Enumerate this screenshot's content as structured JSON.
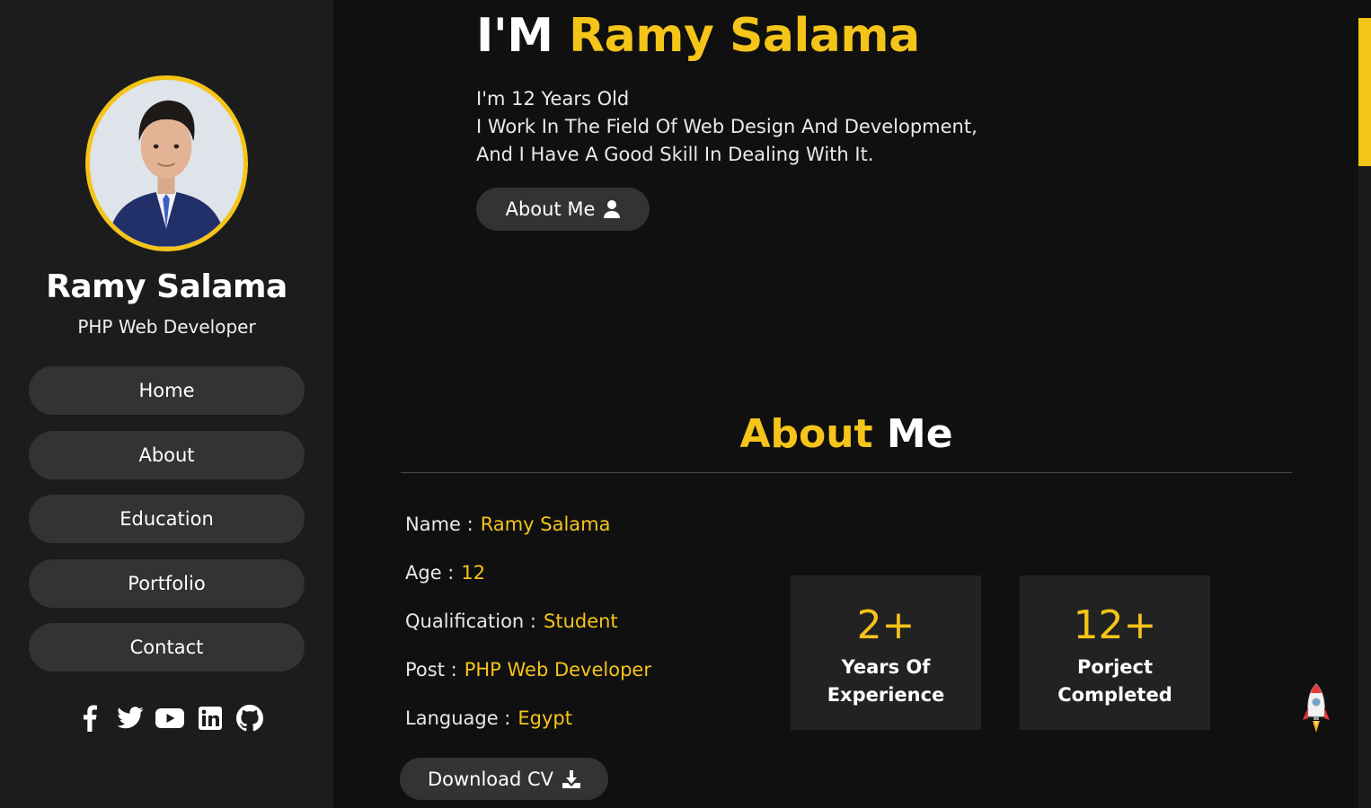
{
  "sidebar": {
    "name": "Ramy Salama",
    "role": "PHP Web Developer",
    "nav": [
      "Home",
      "About",
      "Education",
      "Portfolio",
      "Contact"
    ],
    "social_icons": [
      "facebook-icon",
      "twitter-icon",
      "youtube-icon",
      "linkedin-icon",
      "github-icon"
    ]
  },
  "hero": {
    "prefix": "I'M ",
    "name": "Ramy Salama",
    "lines": [
      "I'm 12 Years Old",
      "I Work In The Field Of Web Design And Development,",
      "And I Have A Good Skill In Dealing With It."
    ],
    "button": "About Me"
  },
  "about": {
    "heading_accent": "About",
    "heading_rest": " Me",
    "info": [
      {
        "label": "Name :",
        "value": "Ramy Salama"
      },
      {
        "label": "Age :",
        "value": "12"
      },
      {
        "label": "Qualification :",
        "value": "Student"
      },
      {
        "label": "Post :",
        "value": "PHP Web Developer"
      },
      {
        "label": "Language :",
        "value": "Egypt"
      }
    ],
    "cv_button": "Download CV",
    "stats": [
      {
        "num": "2+",
        "line1": "Years Of",
        "line2": "Experience"
      },
      {
        "num": "12+",
        "line1": "Porject",
        "line2": "Completed"
      }
    ]
  },
  "colors": {
    "accent": "#f5c419",
    "background": "#101010",
    "sidebar": "#1c1c1c",
    "button": "#333333"
  }
}
